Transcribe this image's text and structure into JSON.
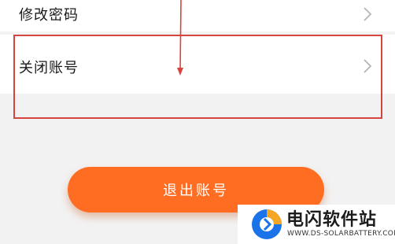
{
  "settings": {
    "change_password_label": "修改密码",
    "close_account_label": "关闭账号"
  },
  "logout": {
    "label": "退出账号"
  },
  "watermark": {
    "name": "电闪软件站",
    "url": "WWW.DS-SOLARBATTERY.COM"
  },
  "colors": {
    "accent": "#ff6d22",
    "annotation": "#d6453d",
    "background": "#f2f2f2"
  },
  "icons": {
    "row_arrow": "chevron-right-icon"
  }
}
